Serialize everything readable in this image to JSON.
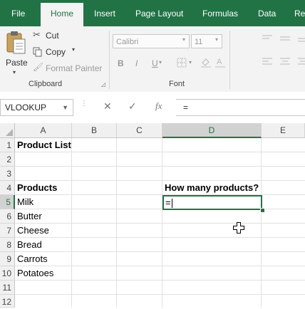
{
  "ribbon_tabs": [
    "File",
    "Home",
    "Insert",
    "Page Layout",
    "Formulas",
    "Data",
    "Re"
  ],
  "active_tab": "Home",
  "clipboard": {
    "paste_label": "Paste",
    "cut_label": "Cut",
    "copy_label": "Copy",
    "format_painter_label": "Format Painter",
    "group_label": "Clipboard"
  },
  "font": {
    "font_name": "Calibri",
    "font_size": "11",
    "bold": "B",
    "italic": "I",
    "underline": "U",
    "group_label": "Font"
  },
  "formula_bar": {
    "name_box": "VLOOKUP",
    "fx": "fx",
    "content": "="
  },
  "columns": [
    "A",
    "B",
    "C",
    "D",
    "E"
  ],
  "rows": [
    "1",
    "2",
    "3",
    "4",
    "5",
    "6",
    "7",
    "8",
    "9",
    "10",
    "11",
    "12"
  ],
  "cells": {
    "A1": "Product List",
    "A4": "Products",
    "D4": "How many products?",
    "A5": "Milk",
    "A6": "Butter",
    "A7": "Cheese",
    "A8": "Bread",
    "A9": "Carrots",
    "A10": "Potatoes"
  },
  "active_cell": {
    "ref": "D5",
    "value": "="
  },
  "colors": {
    "accent": "#217346",
    "ribbon": "#f3f3f3",
    "header": "#f0f0f0"
  }
}
